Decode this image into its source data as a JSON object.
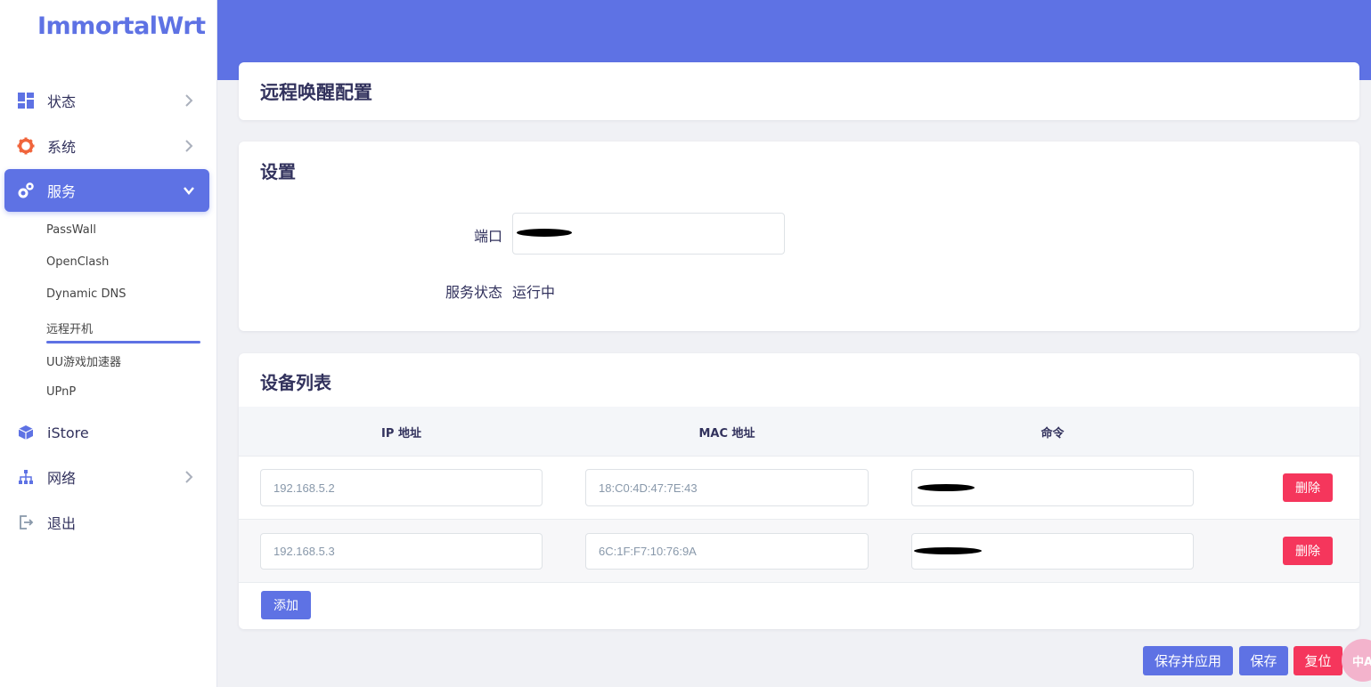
{
  "brand": {
    "logo": "ImmortalWrt"
  },
  "sidebar": {
    "items": [
      {
        "label": "状态",
        "icon": "dashboard-icon",
        "has_chevron": true
      },
      {
        "label": "系统",
        "icon": "gear-icon",
        "has_chevron": true
      },
      {
        "label": "服务",
        "icon": "gears-icon",
        "has_chevron": true,
        "active": true
      },
      {
        "label": "iStore",
        "icon": "cube-icon",
        "has_chevron": false
      },
      {
        "label": "网络",
        "icon": "sitemap-icon",
        "has_chevron": true
      },
      {
        "label": "退出",
        "icon": "logout-icon",
        "has_chevron": false
      }
    ],
    "sub_items": [
      "PassWall",
      "OpenClash",
      "Dynamic DNS",
      "远程开机",
      "UU游戏加速器",
      "UPnP"
    ],
    "current_sub": "远程开机"
  },
  "page": {
    "title": "远程唤醒配置"
  },
  "settings": {
    "title": "设置",
    "port_label": "端口",
    "port_value": "",
    "status_label": "服务状态",
    "status_value": "运行中"
  },
  "devices": {
    "title": "设备列表",
    "columns": [
      "IP 地址",
      "MAC 地址",
      "命令"
    ],
    "rows": [
      {
        "ip": "192.168.5.2",
        "mac": "18:C0:4D:47:7E:43",
        "command": ""
      },
      {
        "ip": "192.168.5.3",
        "mac": "6C:1F:F7:10:76:9A",
        "command": ""
      }
    ],
    "delete_label": "删除",
    "add_label": "添加"
  },
  "footer": {
    "save_apply": "保存并应用",
    "save": "保存",
    "reset": "复位"
  },
  "floating": {
    "label": "中A"
  },
  "colors": {
    "primary": "#5e72e4",
    "danger": "#f5365c",
    "icon_orange": "#f0643b"
  }
}
